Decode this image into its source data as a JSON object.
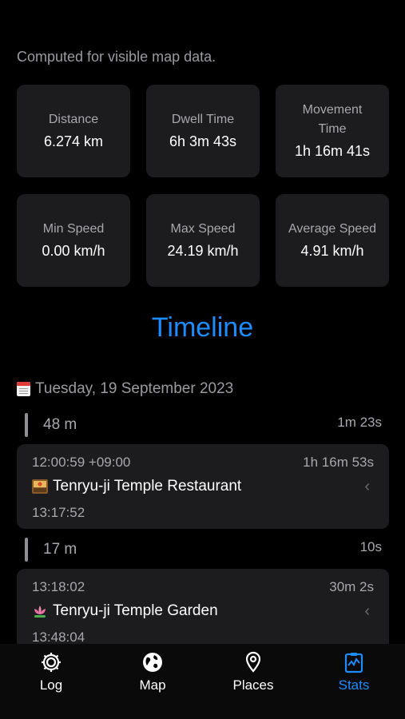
{
  "caption": "Computed for visible map data.",
  "stats": [
    {
      "label": "Distance",
      "value": "6.274 km"
    },
    {
      "label": "Dwell Time",
      "value": "6h 3m 43s"
    },
    {
      "label": "Movement Time",
      "value": "1h 16m 41s"
    },
    {
      "label": "Min Speed",
      "value": "0.00 km/h"
    },
    {
      "label": "Max Speed",
      "value": "24.19 km/h"
    },
    {
      "label": "Average Speed",
      "value": "4.91 km/h"
    }
  ],
  "timeline": {
    "title": "Timeline",
    "date_icon": "calendar-icon",
    "date": "Tuesday, 19 September 2023",
    "moves": [
      {
        "duration": "48 m",
        "right": "1m 23s"
      },
      {
        "duration": "17 m",
        "right": "10s"
      }
    ],
    "visits": [
      {
        "start": "12:00:59 +09:00",
        "duration": "1h 16m 53s",
        "icon": "restaurant-icon",
        "place": "Tenryu-ji Temple Restaurant",
        "end": "13:17:52"
      },
      {
        "start": "13:18:02",
        "duration": "30m 2s",
        "icon": "lotus-icon",
        "place": "Tenryu-ji Temple Garden",
        "end": "13:48:04"
      }
    ]
  },
  "tabs": [
    {
      "label": "Log",
      "icon": "gear-icon",
      "active": false
    },
    {
      "label": "Map",
      "icon": "globe-icon",
      "active": false
    },
    {
      "label": "Places",
      "icon": "location-pin-icon",
      "active": false
    },
    {
      "label": "Stats",
      "icon": "stats-icon",
      "active": true
    }
  ],
  "colors": {
    "accent": "#1d8cff",
    "card": "#1c1c1e",
    "background": "#000000"
  }
}
